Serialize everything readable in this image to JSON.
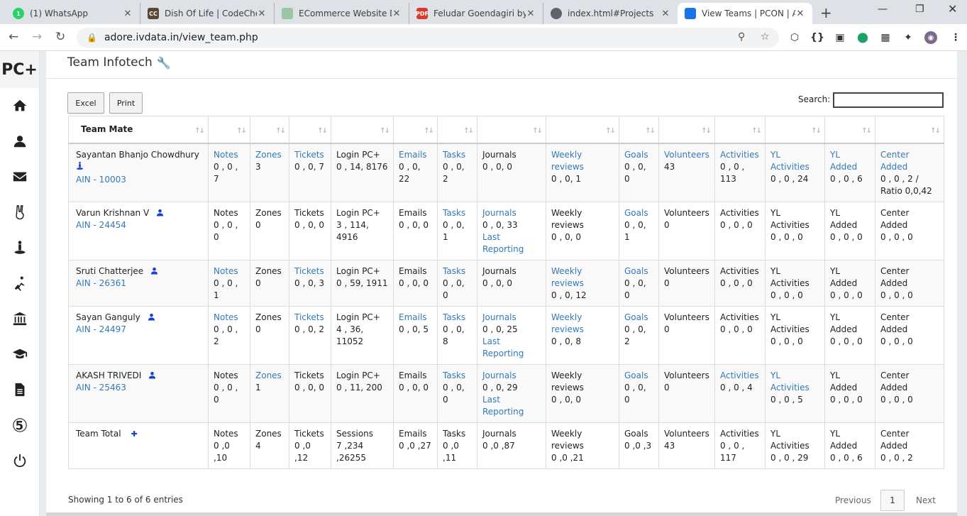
{
  "tabs": [
    {
      "title": "(1) WhatsApp",
      "fav": "whatsapp-icon",
      "fav_text": "1",
      "fav_color": "#25d366"
    },
    {
      "title": "Dish Of Life | CodeChef",
      "fav": "codechef-icon",
      "fav_text": "CC",
      "fav_color": "#5b4638"
    },
    {
      "title": "ECommerce Website De",
      "fav": "ecommerce-icon",
      "fav_text": "",
      "fav_color": "#9bc6a6"
    },
    {
      "title": "Feludar Goendagiri by S",
      "fav": "pdf-icon",
      "fav_text": "PDF",
      "fav_color": "#d93b2b"
    },
    {
      "title": "index.html#Projects",
      "fav": "globe-icon",
      "fav_text": "",
      "fav_color": "#5f6368"
    },
    {
      "title": "View Teams | PCON | Ac",
      "fav": "gear-icon",
      "fav_text": "",
      "fav_color": "#1a73e8"
    }
  ],
  "browser": {
    "url": "adore.ivdata.in/view_team.php"
  },
  "app": {
    "logo": "PC+",
    "title": "Team Infotech"
  },
  "toolbar": {
    "excel": "Excel",
    "print": "Print",
    "search_label": "Search:",
    "search_value": ""
  },
  "headers": [
    "Team Mate",
    "",
    "",
    "",
    "",
    "",
    "",
    "",
    "",
    "",
    "",
    "",
    "",
    "",
    ""
  ],
  "rows": [
    {
      "cells": [
        {
          "name": "Sayantan Bhanjo Chowdhury",
          "ain": "AIN - 10003",
          "user_icon": "leader"
        },
        {
          "label": "Notes",
          "value": "0 , 0 , 7",
          "link": true
        },
        {
          "label": "Zones",
          "value": "3",
          "link": true
        },
        {
          "label": "Tickets",
          "value": "0 , 0, 7",
          "link": true
        },
        {
          "label": "Login PC+",
          "value": "0 , 14, 8176",
          "link": false
        },
        {
          "label": "Emails",
          "value": "0 , 0, 22",
          "link": true
        },
        {
          "label": "Tasks",
          "value": "0 , 0, 2",
          "link": true
        },
        {
          "label": "Journals",
          "value": "0 , 0, 0",
          "link": false
        },
        {
          "label": "Weekly reviews",
          "value": "0 , 0, 1",
          "link": true
        },
        {
          "label": "Goals",
          "value": "0 , 0, 0",
          "link": true
        },
        {
          "label": "Volunteers",
          "value": "43",
          "link": true
        },
        {
          "label": "Activities",
          "value": "0 , 0 , 113",
          "link": true
        },
        {
          "label": "YL Activities",
          "value": "0 , 0 , 24",
          "link": true
        },
        {
          "label": "YL Added",
          "value": "0 , 0 , 6",
          "link": true
        },
        {
          "label": "Center Added",
          "value": "0 , 0 , 2 / Ratio 0,0,42",
          "link": true
        }
      ]
    },
    {
      "cells": [
        {
          "name": "Varun Krishnan V",
          "ain": "AIN - 24454",
          "user_icon": "user"
        },
        {
          "label": "Notes",
          "value": "0 , 0 , 0",
          "link": false
        },
        {
          "label": "Zones",
          "value": "0",
          "link": false
        },
        {
          "label": "Tickets",
          "value": "0 , 0, 0",
          "link": false
        },
        {
          "label": "Login PC+",
          "value": "3 , 114, 4916",
          "link": false
        },
        {
          "label": "Emails",
          "value": "0 , 0, 0",
          "link": false
        },
        {
          "label": "Tasks",
          "value": "0 , 0, 1",
          "link": true
        },
        {
          "label": "Journals",
          "value": "0 , 0, 33",
          "extra": "Last Reporting",
          "link": true
        },
        {
          "label": "Weekly reviews",
          "value": "0 , 0, 0",
          "link": false
        },
        {
          "label": "Goals",
          "value": "0 , 0, 1",
          "link": true
        },
        {
          "label": "Volunteers",
          "value": "0",
          "link": false
        },
        {
          "label": "Activities",
          "value": "0 , 0 , 0",
          "link": false
        },
        {
          "label": "YL Activities",
          "value": "0 , 0 , 0",
          "link": false
        },
        {
          "label": "YL Added",
          "value": "0 , 0 , 0",
          "link": false
        },
        {
          "label": "Center Added",
          "value": "0 , 0 , 0",
          "link": false
        }
      ]
    },
    {
      "cells": [
        {
          "name": "Sruti Chatterjee",
          "ain": "AIN - 26361",
          "user_icon": "user"
        },
        {
          "label": "Notes",
          "value": "0 , 0 , 1",
          "link": true
        },
        {
          "label": "Zones",
          "value": "0",
          "link": false
        },
        {
          "label": "Tickets",
          "value": "0 , 0, 3",
          "link": true
        },
        {
          "label": "Login PC+",
          "value": "0 , 59, 1911",
          "link": false
        },
        {
          "label": "Emails",
          "value": "0 , 0, 0",
          "link": false
        },
        {
          "label": "Tasks",
          "value": "0 , 0, 0",
          "link": true
        },
        {
          "label": "Journals",
          "value": "0 , 0, 0",
          "link": false
        },
        {
          "label": "Weekly reviews",
          "value": "0 , 0, 12",
          "link": true
        },
        {
          "label": "Goals",
          "value": "0 , 0, 0",
          "link": true
        },
        {
          "label": "Volunteers",
          "value": "0",
          "link": false
        },
        {
          "label": "Activities",
          "value": "0 , 0 , 0",
          "link": false
        },
        {
          "label": "YL Activities",
          "value": "0 , 0 , 0",
          "link": false
        },
        {
          "label": "YL Added",
          "value": "0 , 0 , 0",
          "link": false
        },
        {
          "label": "Center Added",
          "value": "0 , 0 , 0",
          "link": false
        }
      ]
    },
    {
      "cells": [
        {
          "name": "Sayan Ganguly",
          "ain": "AIN - 24497",
          "user_icon": "user"
        },
        {
          "label": "Notes",
          "value": "0 , 0 , 2",
          "link": true
        },
        {
          "label": "Zones",
          "value": "0",
          "link": false
        },
        {
          "label": "Tickets",
          "value": "0 , 0, 2",
          "link": true
        },
        {
          "label": "Login PC+",
          "value": "4 , 36, 11052",
          "link": false
        },
        {
          "label": "Emails",
          "value": "0 , 0, 5",
          "link": true
        },
        {
          "label": "Tasks",
          "value": "0 , 0, 8",
          "link": true
        },
        {
          "label": "Journals",
          "value": "0 , 0, 25",
          "extra": "Last Reporting",
          "link": true
        },
        {
          "label": "Weekly reviews",
          "value": "0 , 0, 8",
          "link": true
        },
        {
          "label": "Goals",
          "value": "0 , 0, 2",
          "link": true
        },
        {
          "label": "Volunteers",
          "value": "0",
          "link": false
        },
        {
          "label": "Activities",
          "value": "0 , 0 , 0",
          "link": false
        },
        {
          "label": "YL Activities",
          "value": "0 , 0 , 0",
          "link": false
        },
        {
          "label": "YL Added",
          "value": "0 , 0 , 0",
          "link": false
        },
        {
          "label": "Center Added",
          "value": "0 , 0 , 0",
          "link": false
        }
      ]
    },
    {
      "cells": [
        {
          "name": "AKASH TRIVEDI",
          "ain": "AIN - 25463",
          "user_icon": "user"
        },
        {
          "label": "Notes",
          "value": "0 , 0 , 0",
          "link": false
        },
        {
          "label": "Zones",
          "value": "1",
          "link": true
        },
        {
          "label": "Tickets",
          "value": "0 , 0, 0",
          "link": false
        },
        {
          "label": "Login PC+",
          "value": "0 , 11, 200",
          "link": false
        },
        {
          "label": "Emails",
          "value": "0 , 0, 0",
          "link": false
        },
        {
          "label": "Tasks",
          "value": "0 , 0, 0",
          "link": true
        },
        {
          "label": "Journals",
          "value": "0 , 0, 29",
          "extra": "Last Reporting",
          "link": true
        },
        {
          "label": "Weekly reviews",
          "value": "0 , 0, 0",
          "link": false
        },
        {
          "label": "Goals",
          "value": "0 , 0, 0",
          "link": true
        },
        {
          "label": "Volunteers",
          "value": "0",
          "link": false
        },
        {
          "label": "Activities",
          "value": "0 , 0 , 4",
          "link": true
        },
        {
          "label": "YL Activities",
          "value": "0 , 0 , 5",
          "link": true
        },
        {
          "label": "YL Added",
          "value": "0 , 0 , 0",
          "link": false
        },
        {
          "label": "Center Added",
          "value": "0 , 0 , 0",
          "link": false
        }
      ]
    },
    {
      "cells": [
        {
          "name": "Team Total",
          "ain": "",
          "user_icon": "plus"
        },
        {
          "label": "Notes",
          "value": "0 ,0 ,10",
          "link": false
        },
        {
          "label": "Zones",
          "value": "4",
          "link": false
        },
        {
          "label": "Tickets",
          "value": "0 ,0 ,12",
          "link": false
        },
        {
          "label": "Sessions",
          "value": "7 ,234 ,26255",
          "link": false
        },
        {
          "label": "Emails",
          "value": "0 ,0 ,27",
          "link": false
        },
        {
          "label": "Tasks",
          "value": "0 ,0 ,11",
          "link": false
        },
        {
          "label": "Journals",
          "value": "0 ,0 ,87",
          "link": false
        },
        {
          "label": "Weekly reviews",
          "value": "0 ,0 ,21",
          "link": false
        },
        {
          "label": "Goals",
          "value": "0 ,0 ,3",
          "link": false
        },
        {
          "label": "Volunteers",
          "value": "43",
          "link": false
        },
        {
          "label": "Activities",
          "value": "0 , 0 , 117",
          "link": false
        },
        {
          "label": "YL Activities",
          "value": "0 , 0 , 29",
          "link": false
        },
        {
          "label": "YL Added",
          "value": "0 , 0 , 6",
          "link": false
        },
        {
          "label": "Center Added",
          "value": "0 , 0 , 2",
          "link": false
        }
      ]
    }
  ],
  "footer": {
    "info": "Showing 1 to 6 of 6 entries",
    "previous": "Previous",
    "page": "1",
    "next": "Next"
  },
  "colors": {
    "link": "#337ab7",
    "user_icon": "#1a3ecf",
    "accent_wrench": "#d9342b"
  }
}
